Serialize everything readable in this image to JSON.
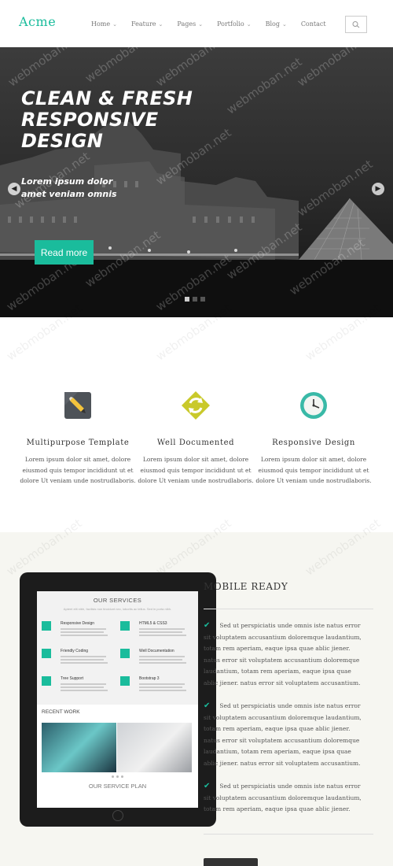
{
  "header": {
    "logo": "Acme",
    "nav": [
      {
        "label": "Home",
        "dropdown": true
      },
      {
        "label": "Feature",
        "dropdown": true
      },
      {
        "label": "Pages",
        "dropdown": true
      },
      {
        "label": "Portfolio",
        "dropdown": true
      },
      {
        "label": "Blog",
        "dropdown": true
      },
      {
        "label": "Contact",
        "dropdown": false
      }
    ],
    "search_icon": "search-icon"
  },
  "hero": {
    "title": "CLEAN & FRESH RESPONSIVE DESIGN",
    "subtitle": "Lorem ipsum dolor amet veniam omnis",
    "button_label": "Read more",
    "prev_arrow": "chevron-left-icon",
    "next_arrow": "chevron-right-icon",
    "slides_count": 3,
    "active_slide": 1
  },
  "features": [
    {
      "icon": "pencil-icon",
      "title": "Multipurpose Template",
      "text": "Lorem ipsum dolor sit amet, dolore eiusmod quis tempor incididunt ut et dolore Ut veniam unde nostrudlaboris."
    },
    {
      "icon": "refresh-icon",
      "title": "Well Documented",
      "text": "Lorem ipsum dolor sit amet, dolore eiusmod quis tempor incididunt ut et dolore Ut veniam unde nostrudlaboris."
    },
    {
      "icon": "clock-icon",
      "title": "Responsive Design",
      "text": "Lorem ipsum dolor sit amet, dolore eiusmod quis tempor incididunt ut et dolore Ut veniam unde nostrudlaboris."
    }
  ],
  "tablet": {
    "services_title": "OUR SERVICES",
    "services_sub": "Aptent elit nibh, facilisis non tincidunt nec, lobortis ac tellus. Sed in porta nibh.",
    "services": [
      {
        "title": "Responsive Design"
      },
      {
        "title": "HTML5 & CSS3"
      },
      {
        "title": "Friendly Coding"
      },
      {
        "title": "Well Documentation"
      },
      {
        "title": "Tree Support"
      },
      {
        "title": "Bootstrap 3"
      }
    ],
    "recent_work_title": "RECENT WORK",
    "service_plan_title": "OUR SERVICE PLAN"
  },
  "mobile": {
    "title": "MOBILE READY",
    "paragraphs": [
      "Sed ut perspiciatis unde omnis iste natus error sit voluptatem accusantium doloremque laudantium, totam rem aperiam, eaque ipsa quae ablic jiener. natus error sit voluptatem accusantium doloremque laudantium, totam rem aperiam, eaque ipsa quae ablic jiener. natus error sit voluptatem accusantium.",
      "Sed ut perspiciatis unde omnis iste natus error sit voluptatem accusantium doloremque laudantium, totam rem aperiam, eaque ipsa quae ablic jiener. natus error sit voluptatem accusantium doloremque laudantium, totam rem aperiam, eaque ipsa quae ablic jiener. natus error sit voluptatem accusantium.",
      "Sed ut perspiciatis unde omnis iste natus error sit voluptatem accusantium doloremque laudantium, totam rem aperiam, eaque ipsa quae ablic jiener."
    ],
    "check_icon": "check-icon"
  },
  "watermark": "webmoban.net",
  "colors": {
    "accent": "#1abc9c",
    "dark": "#333333",
    "bottom_bg": "#f6f6f1"
  }
}
